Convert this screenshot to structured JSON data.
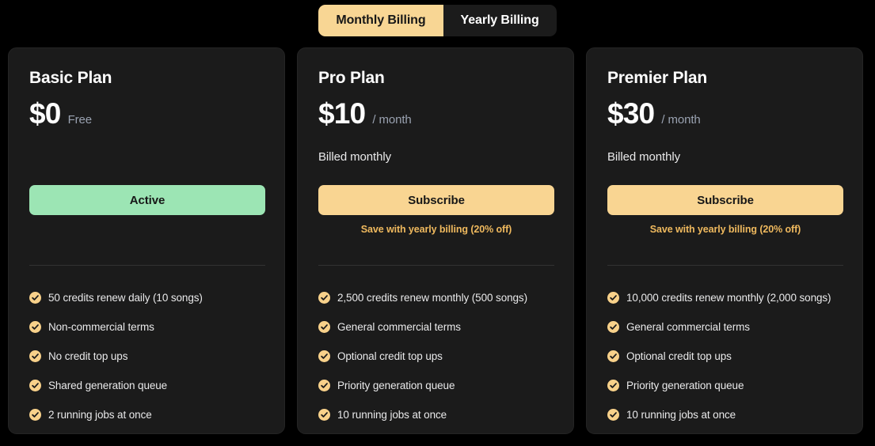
{
  "billing_toggle": {
    "options": [
      {
        "label": "Monthly Billing",
        "selected": true
      },
      {
        "label": "Yearly Billing",
        "selected": false
      }
    ]
  },
  "colors": {
    "page_background": "#000000",
    "card_background": "#1b1b1b",
    "card_border": "#242424",
    "accent_amber": "#f8d694",
    "accent_amber_button": "#f9d592",
    "accent_amber_text": "#efb95e",
    "active_green": "#9ce5b4",
    "text_primary": "#ffffff",
    "text_secondary": "#e9e9ea",
    "text_muted": "#9aa2b1",
    "divider": "#333333"
  },
  "plans": [
    {
      "name": "Basic Plan",
      "price": "$0",
      "period": "Free",
      "billed_note": "",
      "cta_label": "Active",
      "cta_style": "active-plan",
      "save_note": "",
      "features": [
        "50 credits renew daily (10 songs)",
        "Non-commercial terms",
        "No credit top ups",
        "Shared generation queue",
        "2 running jobs at once"
      ]
    },
    {
      "name": "Pro Plan",
      "price": "$10",
      "period": "/ month",
      "billed_note": "Billed monthly",
      "cta_label": "Subscribe",
      "cta_style": "subscribe",
      "save_note": "Save with yearly billing (20% off)",
      "features": [
        "2,500 credits renew monthly (500 songs)",
        "General commercial terms",
        "Optional credit top ups",
        "Priority generation queue",
        "10 running jobs at once"
      ]
    },
    {
      "name": "Premier Plan",
      "price": "$30",
      "period": "/ month",
      "billed_note": "Billed monthly",
      "cta_label": "Subscribe",
      "cta_style": "subscribe",
      "save_note": "Save with yearly billing (20% off)",
      "features": [
        "10,000 credits renew monthly (2,000 songs)",
        "General commercial terms",
        "Optional credit top ups",
        "Priority generation queue",
        "10 running jobs at once"
      ]
    }
  ],
  "icons": {
    "check": "check-circle-icon"
  }
}
